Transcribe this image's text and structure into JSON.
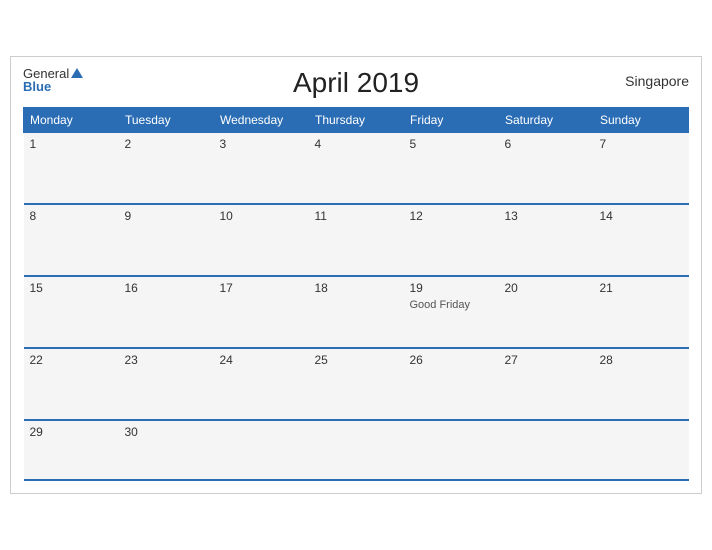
{
  "header": {
    "title": "April 2019",
    "country": "Singapore"
  },
  "logo": {
    "general": "General",
    "blue": "Blue"
  },
  "weekdays": [
    "Monday",
    "Tuesday",
    "Wednesday",
    "Thursday",
    "Friday",
    "Saturday",
    "Sunday"
  ],
  "weeks": [
    [
      {
        "day": "1",
        "holiday": ""
      },
      {
        "day": "2",
        "holiday": ""
      },
      {
        "day": "3",
        "holiday": ""
      },
      {
        "day": "4",
        "holiday": ""
      },
      {
        "day": "5",
        "holiday": ""
      },
      {
        "day": "6",
        "holiday": ""
      },
      {
        "day": "7",
        "holiday": ""
      }
    ],
    [
      {
        "day": "8",
        "holiday": ""
      },
      {
        "day": "9",
        "holiday": ""
      },
      {
        "day": "10",
        "holiday": ""
      },
      {
        "day": "11",
        "holiday": ""
      },
      {
        "day": "12",
        "holiday": ""
      },
      {
        "day": "13",
        "holiday": ""
      },
      {
        "day": "14",
        "holiday": ""
      }
    ],
    [
      {
        "day": "15",
        "holiday": ""
      },
      {
        "day": "16",
        "holiday": ""
      },
      {
        "day": "17",
        "holiday": ""
      },
      {
        "day": "18",
        "holiday": ""
      },
      {
        "day": "19",
        "holiday": "Good Friday"
      },
      {
        "day": "20",
        "holiday": ""
      },
      {
        "day": "21",
        "holiday": ""
      }
    ],
    [
      {
        "day": "22",
        "holiday": ""
      },
      {
        "day": "23",
        "holiday": ""
      },
      {
        "day": "24",
        "holiday": ""
      },
      {
        "day": "25",
        "holiday": ""
      },
      {
        "day": "26",
        "holiday": ""
      },
      {
        "day": "27",
        "holiday": ""
      },
      {
        "day": "28",
        "holiday": ""
      }
    ],
    [
      {
        "day": "29",
        "holiday": ""
      },
      {
        "day": "30",
        "holiday": ""
      },
      {
        "day": "",
        "holiday": ""
      },
      {
        "day": "",
        "holiday": ""
      },
      {
        "day": "",
        "holiday": ""
      },
      {
        "day": "",
        "holiday": ""
      },
      {
        "day": "",
        "holiday": ""
      }
    ]
  ]
}
